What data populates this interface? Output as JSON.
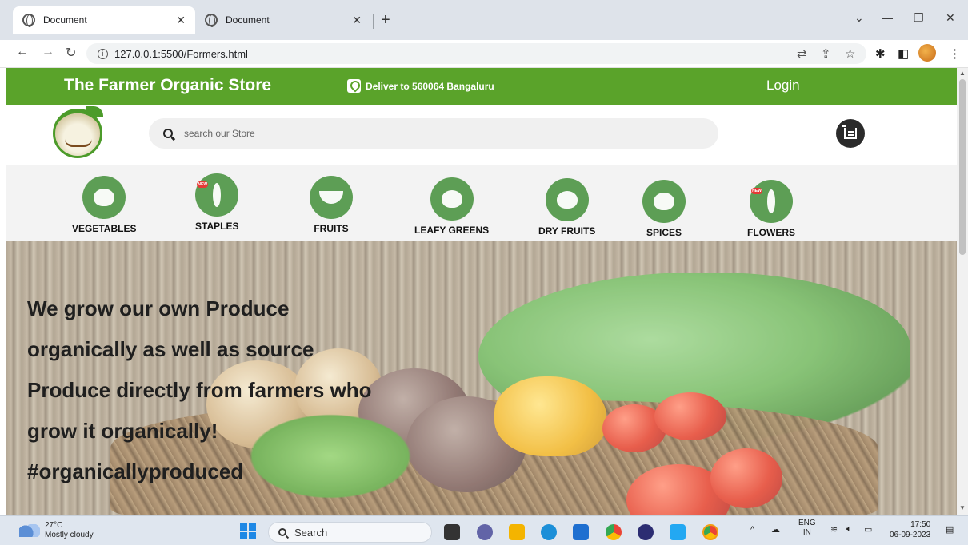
{
  "browser": {
    "tabs": [
      {
        "title": "Document",
        "active": true
      },
      {
        "title": "Document",
        "active": false
      }
    ],
    "new_tab_label": "+",
    "url": "127.0.0.1:5500/Formers.html"
  },
  "header": {
    "title": "The Farmer Organic Store",
    "deliver_text": "Deliver to 560064 Bangaluru",
    "login_label": "Login"
  },
  "search": {
    "placeholder": "search our Store"
  },
  "categories": [
    {
      "label": "VEGETABLES",
      "icon": "vegetables-icon",
      "new": false
    },
    {
      "label": "STAPLES",
      "icon": "wheat-icon",
      "new": true
    },
    {
      "label": "FRUITS",
      "icon": "fruit-bowl-icon",
      "new": false
    },
    {
      "label": "LEAFY GREENS",
      "icon": "leafy-greens-icon",
      "new": false
    },
    {
      "label": "DRY FRUITS",
      "icon": "dry-fruits-icon",
      "new": false
    },
    {
      "label": "SPICES",
      "icon": "spices-icon",
      "new": false
    },
    {
      "label": "FLOWERS",
      "icon": "flower-icon",
      "new": true
    }
  ],
  "badge_text": "NEW",
  "hero": {
    "lines": [
      "We grow our own Produce",
      "organically as well as source",
      "Produce directly from farmers who",
      "grow it organically!",
      "#organicallyproduced"
    ]
  },
  "taskbar": {
    "weather_temp": "27°C",
    "weather_desc": "Mostly cloudy",
    "search_label": "Search",
    "lang_line1": "ENG",
    "lang_line2": "IN",
    "time": "17:50",
    "date": "06-09-2023"
  },
  "colors": {
    "brand_green": "#5aa32a",
    "category_green": "#5d9e55"
  }
}
